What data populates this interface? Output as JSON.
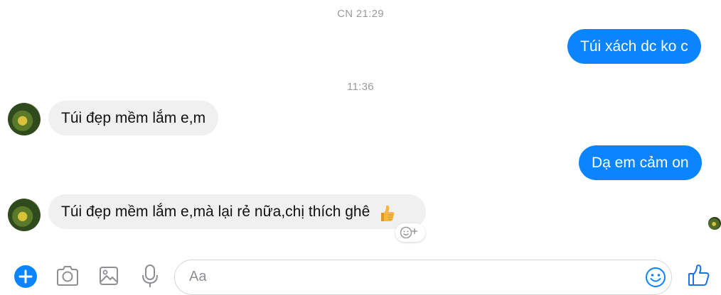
{
  "timestamps": [
    "CN 21:29",
    "11:36"
  ],
  "messages": [
    {
      "side": "out",
      "text": "Túi xách dc ko c"
    },
    {
      "side": "in",
      "text": "Túi đẹp mềm lắm e,m"
    },
    {
      "side": "out",
      "text": "Dạ em cảm on"
    },
    {
      "side": "in",
      "text": "Túi đẹp mềm lắm e,mà lại rẻ nữa,chị thích ghê"
    }
  ],
  "composer": {
    "placeholder": "Aa"
  },
  "toolbar_icons": [
    "plus-icon",
    "camera-icon",
    "image-icon",
    "microphone-icon"
  ],
  "composer_icons": [
    "emoji-icon",
    "thumbs-up-icon"
  ],
  "colors": {
    "accent": "#0a84ff",
    "incoming_bubble": "#f0f0f0",
    "timestamp": "#9a9a9e",
    "like": "#1a73e8"
  }
}
